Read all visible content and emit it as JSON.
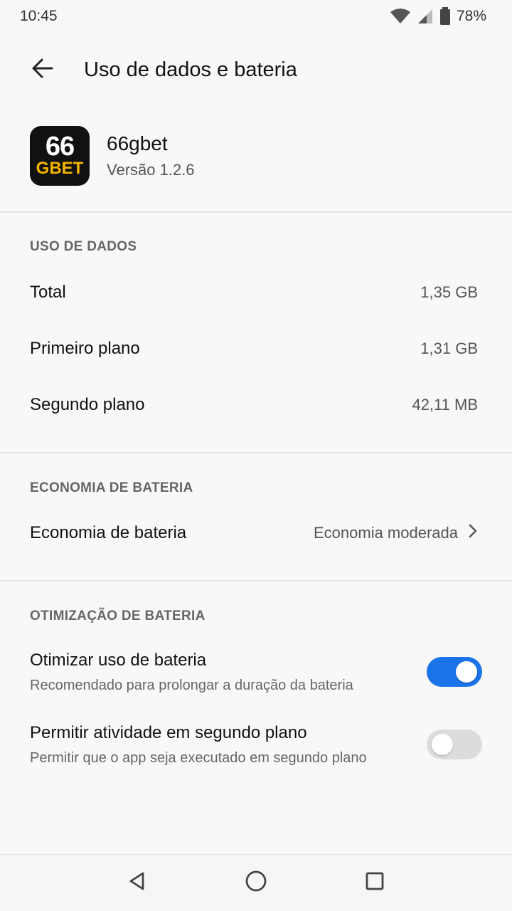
{
  "status_bar": {
    "time": "10:45",
    "battery_percent": "78%"
  },
  "header": {
    "title": "Uso de dados e bateria"
  },
  "app": {
    "logo_top": "66",
    "logo_bottom": "GBET",
    "name": "66gbet",
    "version": "Versão 1.2.6"
  },
  "data_usage": {
    "section_title": "USO DE DADOS",
    "rows": [
      {
        "label": "Total",
        "value": "1,35 GB"
      },
      {
        "label": "Primeiro plano",
        "value": "1,31 GB"
      },
      {
        "label": "Segundo plano",
        "value": "42,11 MB"
      }
    ]
  },
  "battery_saver": {
    "section_title": "ECONOMIA DE BATERIA",
    "label": "Economia de bateria",
    "value": "Economia moderada"
  },
  "battery_optimization": {
    "section_title": "OTIMIZAÇÃO DE BATERIA",
    "items": [
      {
        "title": "Otimizar uso de bateria",
        "subtitle": "Recomendado para prolongar a duração da bateria",
        "enabled": true
      },
      {
        "title": "Permitir atividade em segundo plano",
        "subtitle": "Permitir que o app seja executado em segundo plano",
        "enabled": false
      }
    ]
  },
  "colors": {
    "accent": "#1a73e8",
    "switch_off": "#dcdcdc",
    "logo_bg": "#111111",
    "logo_accent": "#f5b400"
  }
}
